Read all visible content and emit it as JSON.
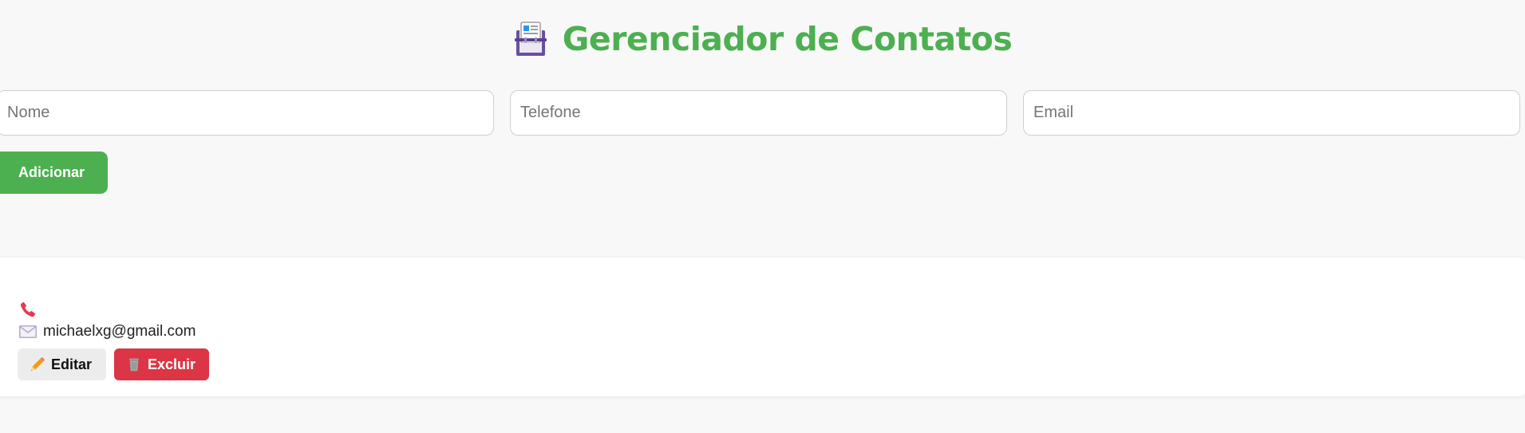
{
  "header": {
    "title": "Gerenciador de Contatos",
    "icon": "card-index-icon"
  },
  "form": {
    "name_placeholder": "Nome",
    "phone_placeholder": "Telefone",
    "email_placeholder": "Email",
    "name_value": "",
    "phone_value": "",
    "email_value": "",
    "add_label": "Adicionar"
  },
  "contacts": [
    {
      "name": "",
      "phone": "",
      "email": "michaelxg@gmail.com",
      "phone_icon": "telephone-icon",
      "email_icon": "envelope-icon",
      "edit_label": "Editar",
      "edit_icon": "pencil-icon",
      "delete_label": "Excluir",
      "delete_icon": "wastebasket-icon"
    }
  ],
  "colors": {
    "brand_green": "#4caf50",
    "danger_red": "#dc3545",
    "background": "#f8f8f8",
    "card": "#ffffff"
  }
}
